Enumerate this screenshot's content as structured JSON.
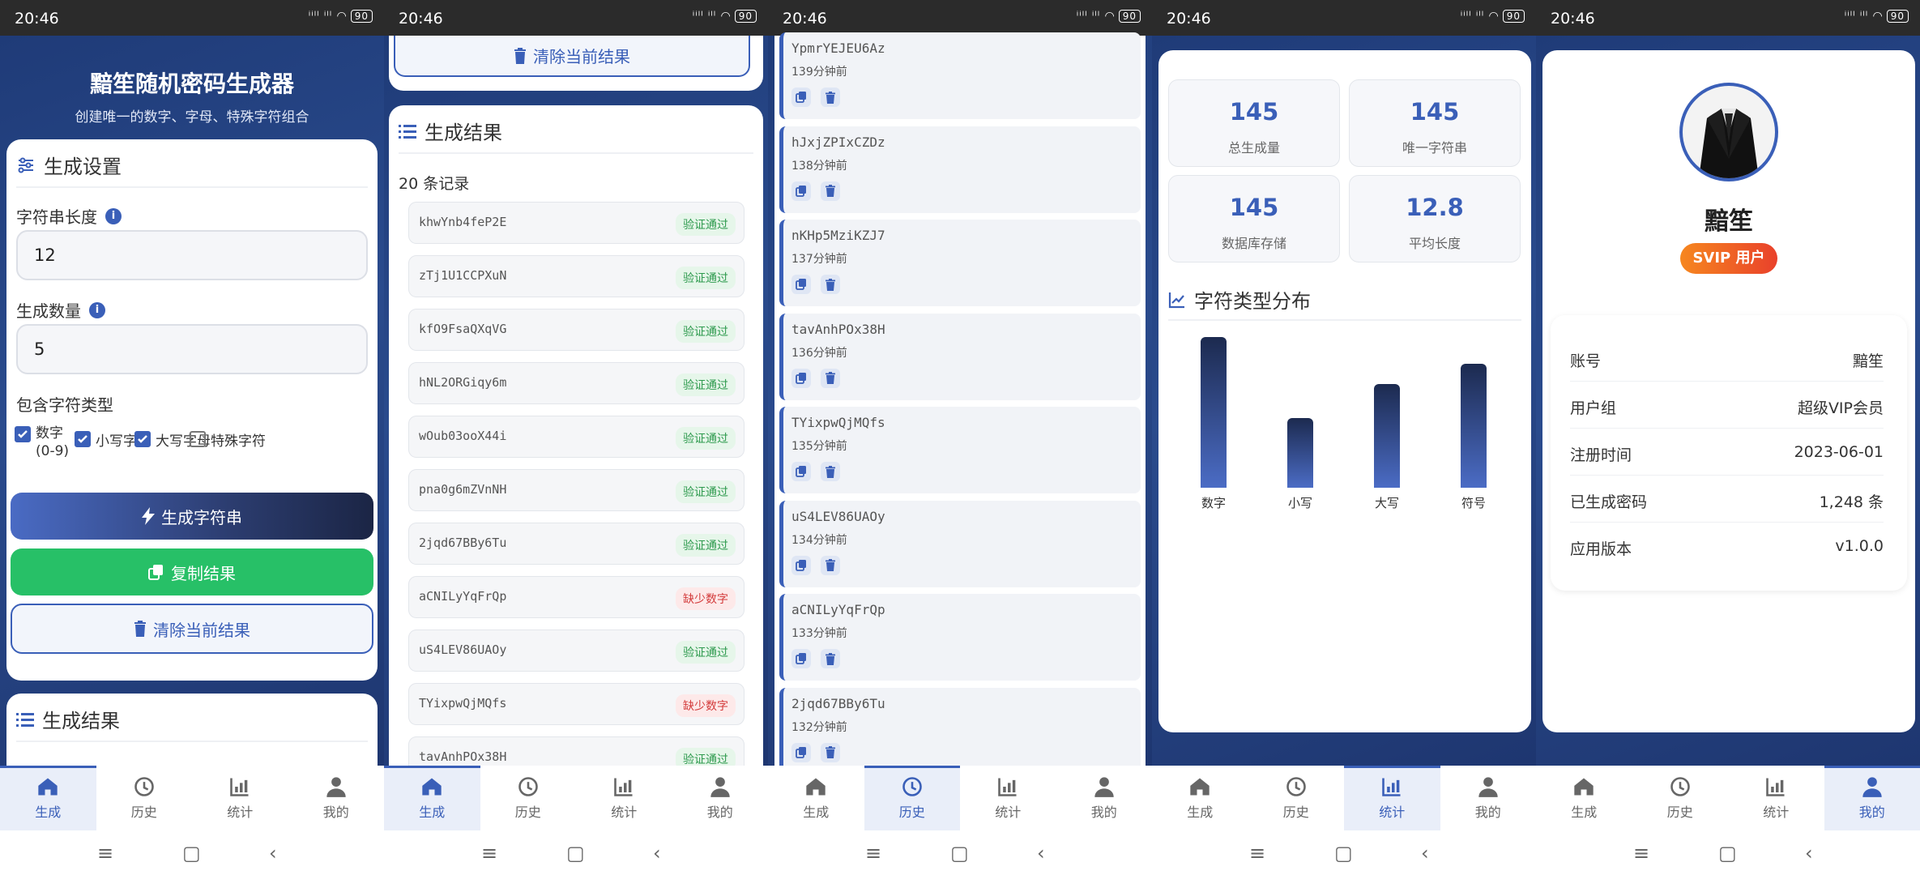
{
  "status": {
    "time": "20:46",
    "signal": "ⁱⁱˡˡ ⁱˡˡ",
    "battery": "90"
  },
  "nav": {
    "items": [
      {
        "label": "生成",
        "icon": "home-icon"
      },
      {
        "label": "历史",
        "icon": "history-icon"
      },
      {
        "label": "统计",
        "icon": "stats-icon"
      },
      {
        "label": "我的",
        "icon": "user-icon"
      }
    ]
  },
  "generator": {
    "title": "黯笙随机密码生成器",
    "subtitle": "创建唯一的数字、字母、特殊字符组合",
    "settings_title": "生成设置",
    "length_label": "字符串长度",
    "length_value": "12",
    "count_label": "生成数量",
    "count_value": "5",
    "types_label": "包含字符类型",
    "types": [
      {
        "label": "数字 (0-9)",
        "checked": true
      },
      {
        "label": "小写字母",
        "checked": true
      },
      {
        "label": "大写字母",
        "checked": true
      },
      {
        "label": "特殊字符",
        "checked": false
      }
    ],
    "generate_button": "生成字符串",
    "copy_button": "复制结果",
    "clear_button": "清除当前结果",
    "results_title": "生成结果"
  },
  "results": {
    "clear_button": "清除当前结果",
    "title": "生成结果",
    "count_text": "20 条记录",
    "items": [
      {
        "value": "khwYnb4feP2E",
        "status": "验证通过",
        "ok": true
      },
      {
        "value": "zTj1U1CCPXuN",
        "status": "验证通过",
        "ok": true
      },
      {
        "value": "kfO9FsaQXqVG",
        "status": "验证通过",
        "ok": true
      },
      {
        "value": "hNL2ORGiqy6m",
        "status": "验证通过",
        "ok": true
      },
      {
        "value": "wOub03ooX44i",
        "status": "验证通过",
        "ok": true
      },
      {
        "value": "pna0g6mZVnNH",
        "status": "验证通过",
        "ok": true
      },
      {
        "value": "2jqd67BBy6Tu",
        "status": "验证通过",
        "ok": true
      },
      {
        "value": "aCNILyYqFrQp",
        "status": "缺少数字",
        "ok": false
      },
      {
        "value": "uS4LEV86UAOy",
        "status": "验证通过",
        "ok": true
      },
      {
        "value": "TYixpwQjMQfs",
        "status": "缺少数字",
        "ok": false
      },
      {
        "value": "tavAnhPOx38H",
        "status": "验证通过",
        "ok": true
      }
    ]
  },
  "history": {
    "items": [
      {
        "value": "YpmrYEJEU6Az",
        "time": "139分钟前"
      },
      {
        "value": "hJxjZPIxCZDz",
        "time": "138分钟前"
      },
      {
        "value": "nKHp5MziKZJ7",
        "time": "137分钟前"
      },
      {
        "value": "tavAnhPOx38H",
        "time": "136分钟前"
      },
      {
        "value": "TYixpwQjMQfs",
        "time": "135分钟前"
      },
      {
        "value": "uS4LEV86UAOy",
        "time": "134分钟前"
      },
      {
        "value": "aCNILyYqFrQp",
        "time": "133分钟前"
      },
      {
        "value": "2jqd67BBy6Tu",
        "time": "132分钟前"
      }
    ]
  },
  "stats": {
    "boxes": [
      {
        "value": "145",
        "label": "总生成量"
      },
      {
        "value": "145",
        "label": "唯一字符串"
      },
      {
        "value": "145",
        "label": "数据库存储"
      },
      {
        "value": "12.8",
        "label": "平均长度"
      }
    ],
    "chart_title": "字符类型分布"
  },
  "chart_data": {
    "type": "bar",
    "title": "字符类型分布",
    "categories": [
      "数字",
      "小写",
      "大写",
      "符号"
    ],
    "values": [
      100,
      46,
      69,
      82
    ],
    "ylim": [
      0,
      100
    ],
    "grid": false,
    "colors": {
      "top": "#1c2a4f",
      "bottom": "#4b6cc5"
    }
  },
  "profile": {
    "name": "黯笙",
    "badge": "SVIP 用户",
    "rows": [
      {
        "key": "账号",
        "value": "黯笙"
      },
      {
        "key": "用户组",
        "value": "超级VIP会员"
      },
      {
        "key": "注册时间",
        "value": "2023-06-01"
      },
      {
        "key": "已生成密码",
        "value": "1,248 条"
      },
      {
        "key": "应用版本",
        "value": "v1.0.0"
      }
    ]
  },
  "colors": {
    "primary": "#3a5fb8",
    "success": "#27c067",
    "danger": "#d33a3a",
    "header_bg": "#1f3b78"
  }
}
